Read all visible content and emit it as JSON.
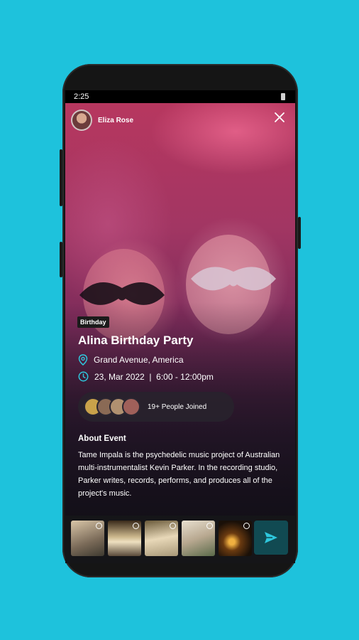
{
  "status_bar": {
    "time": "2:25"
  },
  "host": {
    "name": "Eliza Rose"
  },
  "event": {
    "category": "Birthday",
    "title": "Alina Birthday Party",
    "location": "Grand Avenue, America",
    "datetime": "23, Mar 2022  |  6:00 - 12:00pm",
    "people_joined": "19+ People Joined",
    "about_heading": "About Event",
    "about_text": "Tame Impala is the psychedelic music project of Australian multi-instrumentalist Kevin Parker. In the recording studio, Parker writes, records, performs, and produces all of the project's music."
  },
  "icons": {
    "close": "close-icon",
    "location": "location-pin-icon",
    "clock": "clock-icon",
    "send": "send-icon"
  },
  "colors": {
    "background": "#1ec2dc",
    "accent": "#2ec7dd",
    "send_button": "#114a52"
  }
}
